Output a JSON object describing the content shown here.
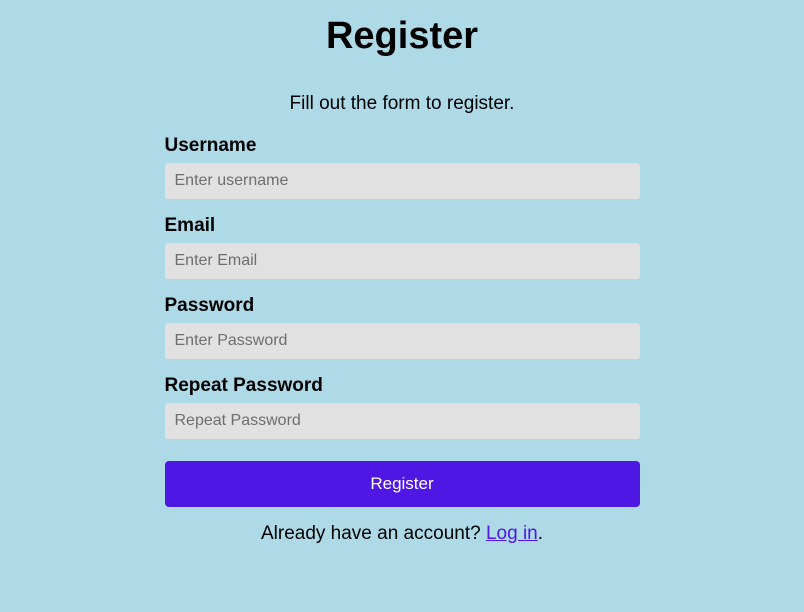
{
  "title": "Register",
  "subtitle": "Fill out the form to register.",
  "fields": {
    "username": {
      "label": "Username",
      "placeholder": "Enter username"
    },
    "email": {
      "label": "Email",
      "placeholder": "Enter Email"
    },
    "password": {
      "label": "Password",
      "placeholder": "Enter Password"
    },
    "repeatPassword": {
      "label": "Repeat Password",
      "placeholder": "Repeat Password"
    }
  },
  "button": {
    "label": "Register"
  },
  "footer": {
    "text": "Already have an account? ",
    "linkText": "Log in",
    "suffix": "."
  }
}
